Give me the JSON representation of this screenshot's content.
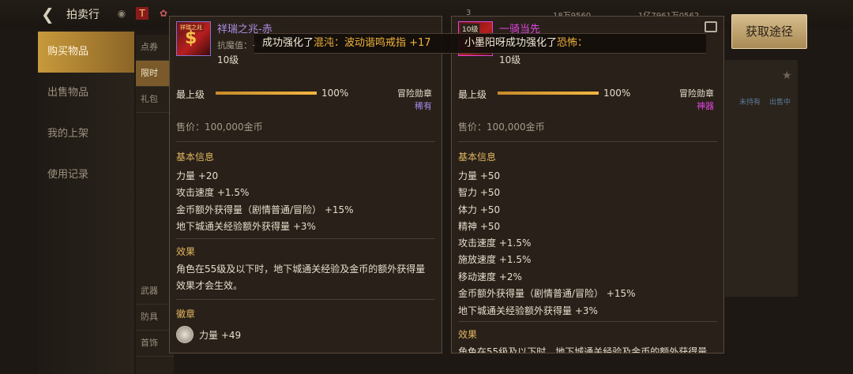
{
  "app": {
    "title": "拍卖行",
    "currency_a": "18万9560",
    "currency_b": "1亿7961万0562",
    "tab_count": "3"
  },
  "nav": {
    "items": [
      {
        "label": "购买物品",
        "active": true
      },
      {
        "label": "出售物品",
        "active": false
      },
      {
        "label": "我的上架",
        "active": false
      },
      {
        "label": "使用记录",
        "active": false
      }
    ]
  },
  "categories": [
    "点券",
    "限时",
    "礼包",
    "武器",
    "防具",
    "首饰"
  ],
  "acquire_button": "获取途径",
  "faded": {
    "a": "未持有",
    "b": "出售中"
  },
  "notify": {
    "seg1_prefix": "成功强化了",
    "seg1_item": "混沌：波动谐鸣戒指 +17",
    "seg2_prefix": "小墨阳呀成功强化了",
    "seg2_item": "恐怖："
  },
  "left_item": {
    "name": "祥瑞之兆-赤",
    "name_color": "#b08fe8",
    "resist": "抗魔值：+1",
    "level": "10级",
    "max_label": "最上级",
    "progress": 1.0,
    "progress_text": "100%",
    "medal_label": "冒险勋章",
    "rarity": "稀有",
    "rarity_color": "#a78ae8",
    "price": "售价：100,000金币",
    "basic_title": "基本信息",
    "stats": [
      "力量 +20",
      "攻击速度 +1.5%",
      "金币额外获得量（剧情普通/冒险） +15%",
      "地下城通关经验额外获得量 +3%"
    ],
    "effect_title": "效果",
    "effect_text": "角色在55级及以下时，地下城通关经验及金币的额外获得量效果才会生效。",
    "badge_title": "徽章",
    "badge_stat": "力量 +49",
    "icon_tag": "祥瑞之兆"
  },
  "right_item": {
    "name": "一骑当先",
    "name_color": "#e046e0",
    "level_badge": "10级",
    "level": "10级",
    "max_label": "最上级",
    "progress": 1.0,
    "progress_text": "100%",
    "medal_label": "冒险勋章",
    "rarity": "神器",
    "rarity_color": "#e046e0",
    "price": "售价：100,000金币",
    "basic_title": "基本信息",
    "stats": [
      "力量 +50",
      "智力 +50",
      "体力 +50",
      "精神 +50",
      "攻击速度 +1.5%",
      "施放速度 +1.5%",
      "移动速度 +2%",
      "金币额外获得量（剧情普通/冒险） +15%",
      "地下城通关经验额外获得量 +3%"
    ],
    "effect_title": "效果",
    "effect_text": "角色在55级及以下时，地下城通关经验及金币的额外获得量"
  },
  "icons": [
    "back-arrow-icon",
    "star-icon",
    "share-icon",
    "gold-coin-icon",
    "diamond-icon"
  ]
}
